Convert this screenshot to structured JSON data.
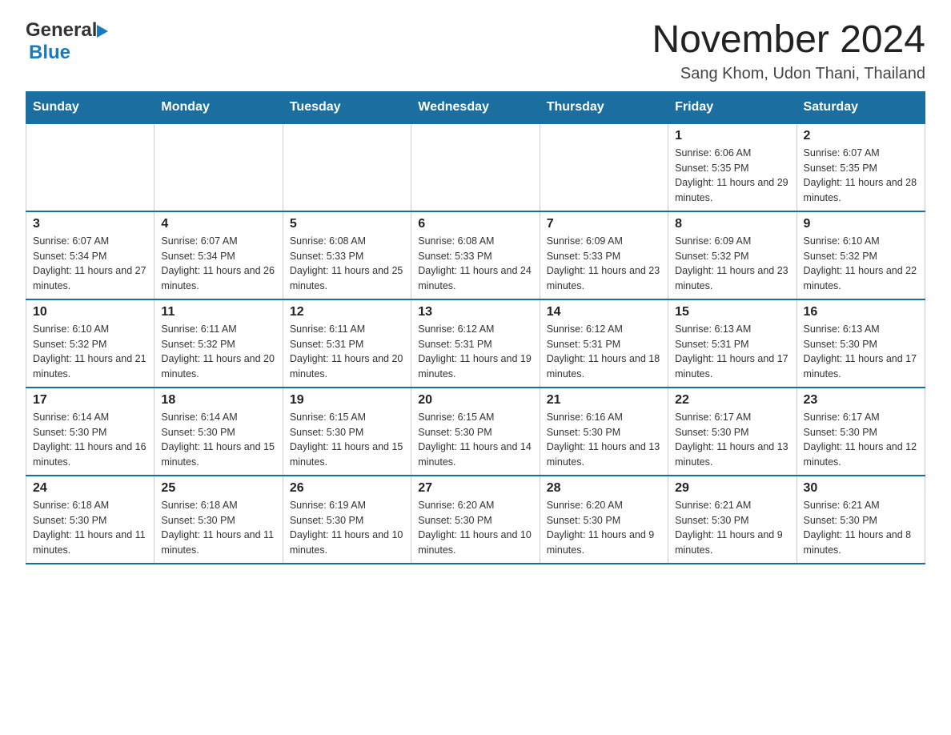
{
  "logo": {
    "general": "General",
    "blue": "Blue"
  },
  "header": {
    "title": "November 2024",
    "subtitle": "Sang Khom, Udon Thani, Thailand"
  },
  "days_of_week": [
    "Sunday",
    "Monday",
    "Tuesday",
    "Wednesday",
    "Thursday",
    "Friday",
    "Saturday"
  ],
  "weeks": [
    {
      "days": [
        {
          "number": "",
          "info": ""
        },
        {
          "number": "",
          "info": ""
        },
        {
          "number": "",
          "info": ""
        },
        {
          "number": "",
          "info": ""
        },
        {
          "number": "",
          "info": ""
        },
        {
          "number": "1",
          "info": "Sunrise: 6:06 AM\nSunset: 5:35 PM\nDaylight: 11 hours and 29 minutes."
        },
        {
          "number": "2",
          "info": "Sunrise: 6:07 AM\nSunset: 5:35 PM\nDaylight: 11 hours and 28 minutes."
        }
      ]
    },
    {
      "days": [
        {
          "number": "3",
          "info": "Sunrise: 6:07 AM\nSunset: 5:34 PM\nDaylight: 11 hours and 27 minutes."
        },
        {
          "number": "4",
          "info": "Sunrise: 6:07 AM\nSunset: 5:34 PM\nDaylight: 11 hours and 26 minutes."
        },
        {
          "number": "5",
          "info": "Sunrise: 6:08 AM\nSunset: 5:33 PM\nDaylight: 11 hours and 25 minutes."
        },
        {
          "number": "6",
          "info": "Sunrise: 6:08 AM\nSunset: 5:33 PM\nDaylight: 11 hours and 24 minutes."
        },
        {
          "number": "7",
          "info": "Sunrise: 6:09 AM\nSunset: 5:33 PM\nDaylight: 11 hours and 23 minutes."
        },
        {
          "number": "8",
          "info": "Sunrise: 6:09 AM\nSunset: 5:32 PM\nDaylight: 11 hours and 23 minutes."
        },
        {
          "number": "9",
          "info": "Sunrise: 6:10 AM\nSunset: 5:32 PM\nDaylight: 11 hours and 22 minutes."
        }
      ]
    },
    {
      "days": [
        {
          "number": "10",
          "info": "Sunrise: 6:10 AM\nSunset: 5:32 PM\nDaylight: 11 hours and 21 minutes."
        },
        {
          "number": "11",
          "info": "Sunrise: 6:11 AM\nSunset: 5:32 PM\nDaylight: 11 hours and 20 minutes."
        },
        {
          "number": "12",
          "info": "Sunrise: 6:11 AM\nSunset: 5:31 PM\nDaylight: 11 hours and 20 minutes."
        },
        {
          "number": "13",
          "info": "Sunrise: 6:12 AM\nSunset: 5:31 PM\nDaylight: 11 hours and 19 minutes."
        },
        {
          "number": "14",
          "info": "Sunrise: 6:12 AM\nSunset: 5:31 PM\nDaylight: 11 hours and 18 minutes."
        },
        {
          "number": "15",
          "info": "Sunrise: 6:13 AM\nSunset: 5:31 PM\nDaylight: 11 hours and 17 minutes."
        },
        {
          "number": "16",
          "info": "Sunrise: 6:13 AM\nSunset: 5:30 PM\nDaylight: 11 hours and 17 minutes."
        }
      ]
    },
    {
      "days": [
        {
          "number": "17",
          "info": "Sunrise: 6:14 AM\nSunset: 5:30 PM\nDaylight: 11 hours and 16 minutes."
        },
        {
          "number": "18",
          "info": "Sunrise: 6:14 AM\nSunset: 5:30 PM\nDaylight: 11 hours and 15 minutes."
        },
        {
          "number": "19",
          "info": "Sunrise: 6:15 AM\nSunset: 5:30 PM\nDaylight: 11 hours and 15 minutes."
        },
        {
          "number": "20",
          "info": "Sunrise: 6:15 AM\nSunset: 5:30 PM\nDaylight: 11 hours and 14 minutes."
        },
        {
          "number": "21",
          "info": "Sunrise: 6:16 AM\nSunset: 5:30 PM\nDaylight: 11 hours and 13 minutes."
        },
        {
          "number": "22",
          "info": "Sunrise: 6:17 AM\nSunset: 5:30 PM\nDaylight: 11 hours and 13 minutes."
        },
        {
          "number": "23",
          "info": "Sunrise: 6:17 AM\nSunset: 5:30 PM\nDaylight: 11 hours and 12 minutes."
        }
      ]
    },
    {
      "days": [
        {
          "number": "24",
          "info": "Sunrise: 6:18 AM\nSunset: 5:30 PM\nDaylight: 11 hours and 11 minutes."
        },
        {
          "number": "25",
          "info": "Sunrise: 6:18 AM\nSunset: 5:30 PM\nDaylight: 11 hours and 11 minutes."
        },
        {
          "number": "26",
          "info": "Sunrise: 6:19 AM\nSunset: 5:30 PM\nDaylight: 11 hours and 10 minutes."
        },
        {
          "number": "27",
          "info": "Sunrise: 6:20 AM\nSunset: 5:30 PM\nDaylight: 11 hours and 10 minutes."
        },
        {
          "number": "28",
          "info": "Sunrise: 6:20 AM\nSunset: 5:30 PM\nDaylight: 11 hours and 9 minutes."
        },
        {
          "number": "29",
          "info": "Sunrise: 6:21 AM\nSunset: 5:30 PM\nDaylight: 11 hours and 9 minutes."
        },
        {
          "number": "30",
          "info": "Sunrise: 6:21 AM\nSunset: 5:30 PM\nDaylight: 11 hours and 8 minutes."
        }
      ]
    }
  ]
}
